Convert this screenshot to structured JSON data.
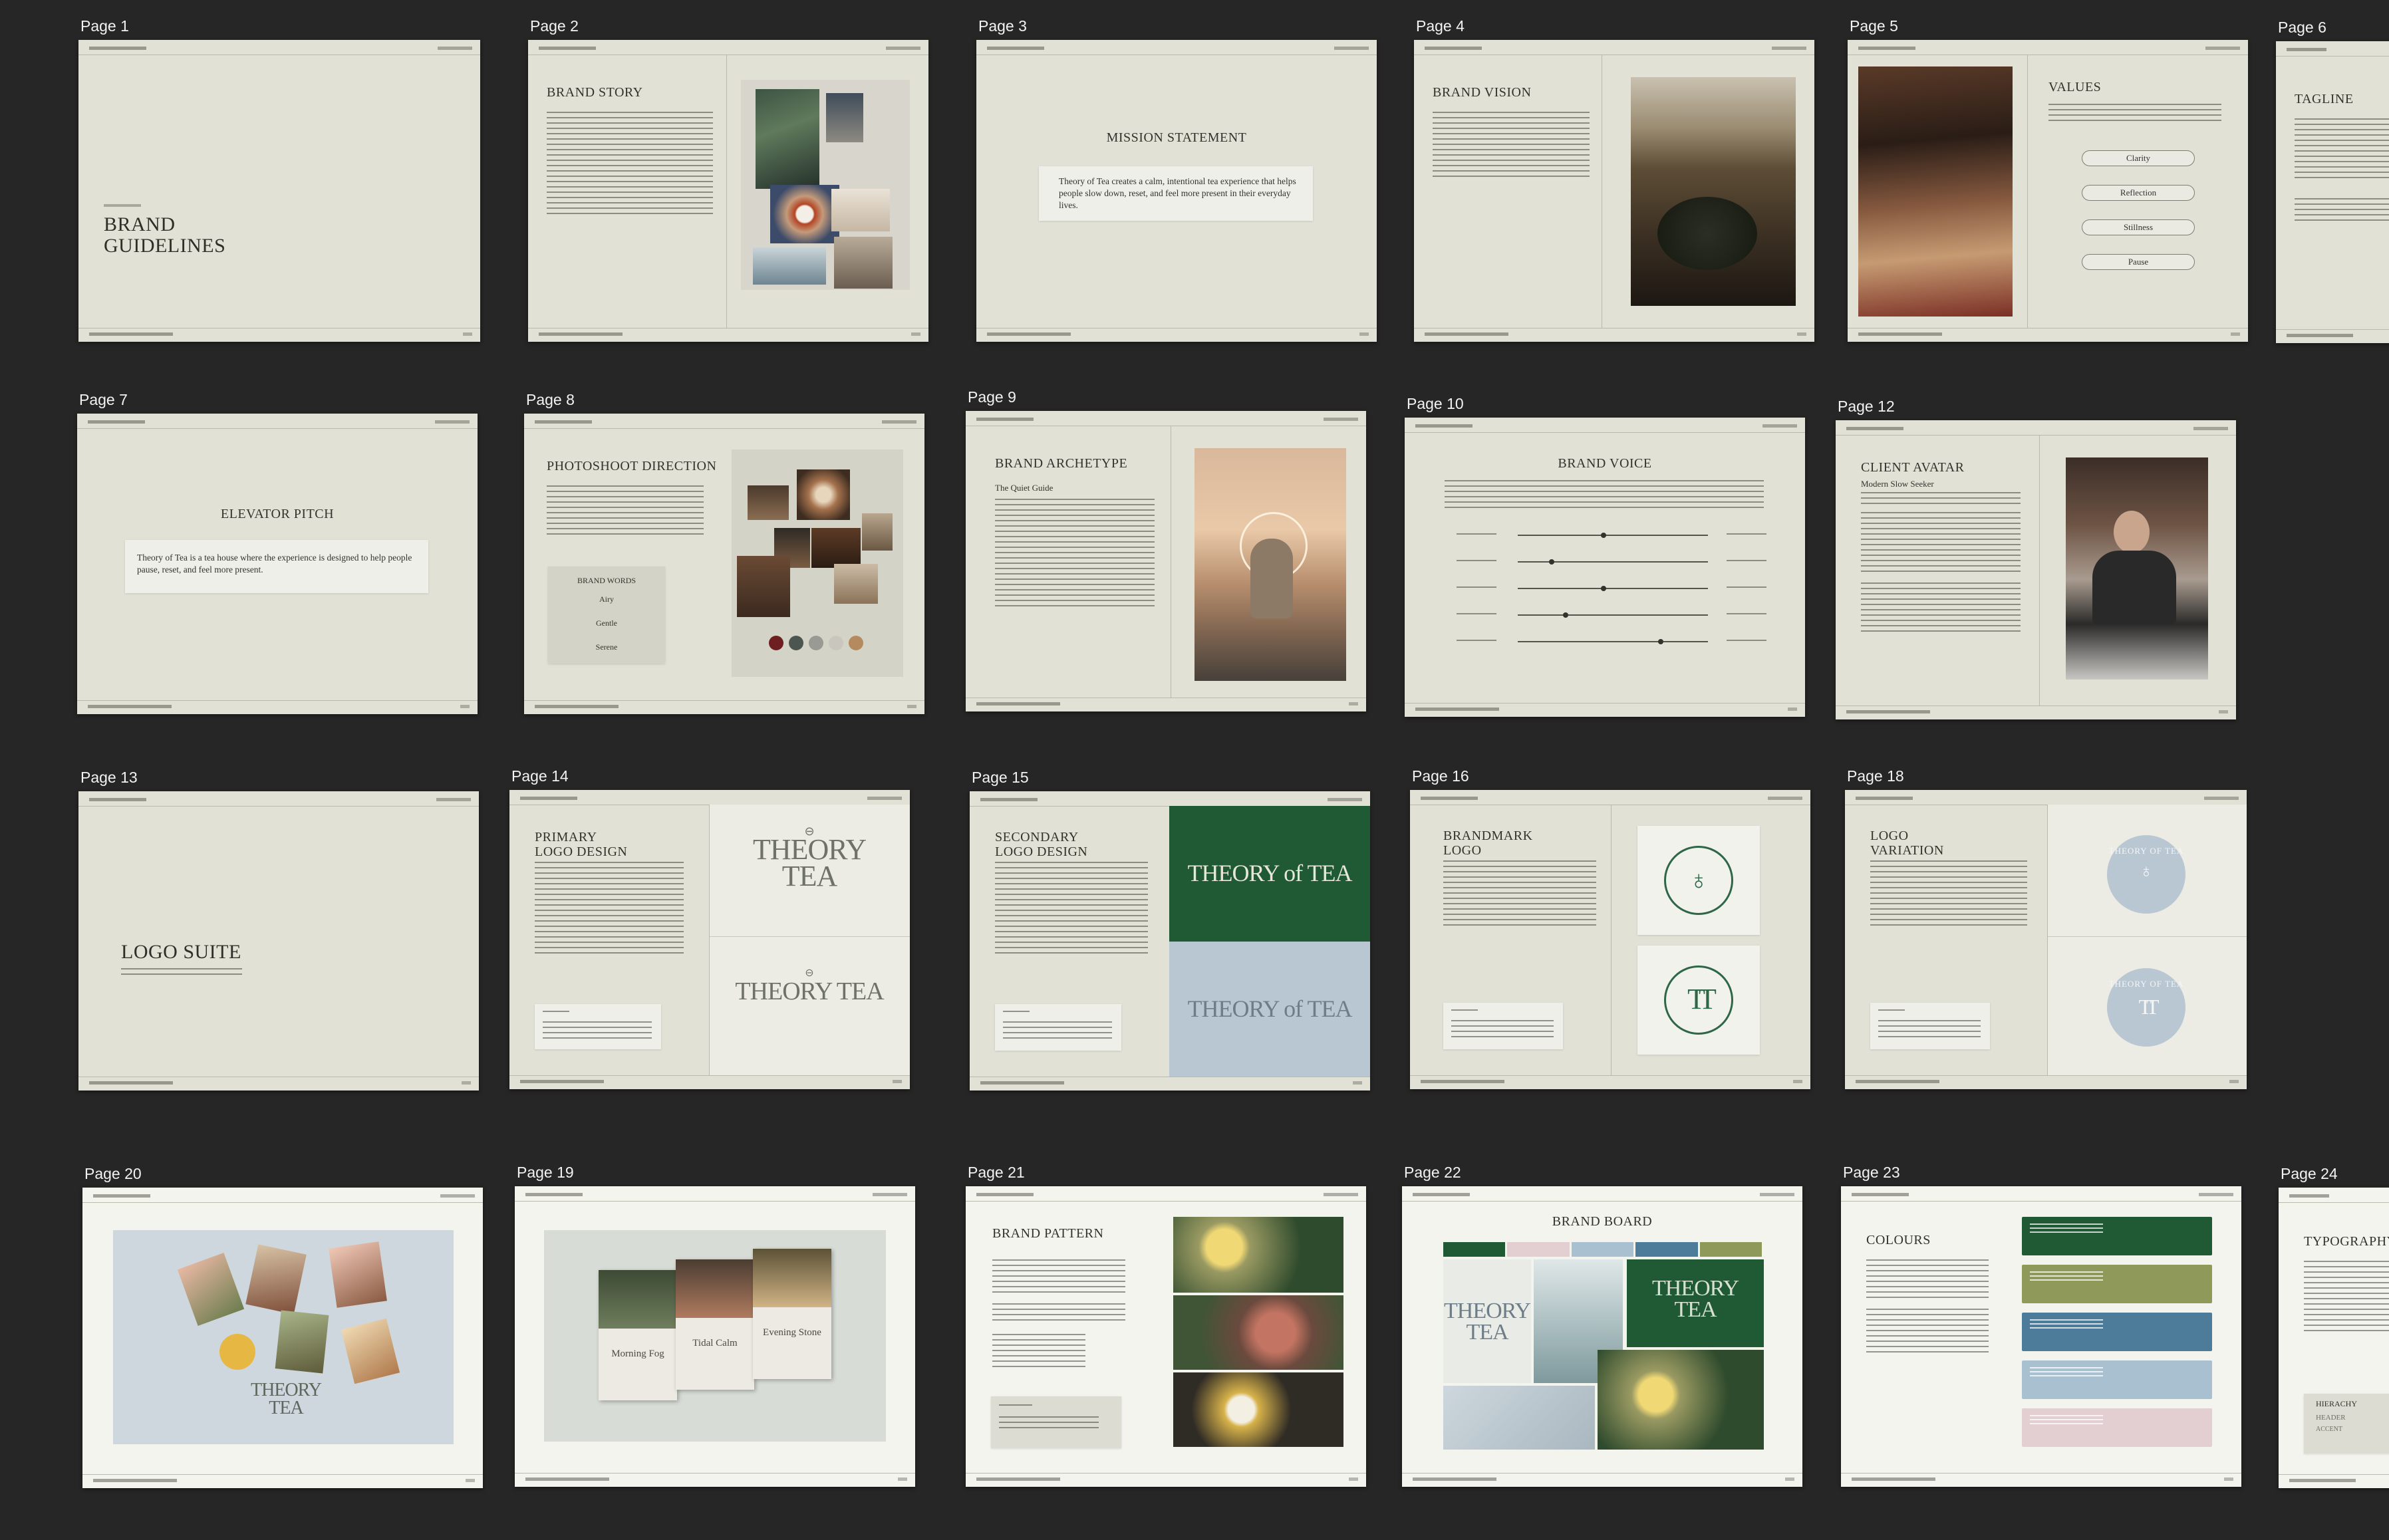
{
  "pages": {
    "p1": {
      "label": "Page 1",
      "title": "BRAND\nGUIDELINES"
    },
    "p2": {
      "label": "Page 2",
      "title": "BRAND STORY"
    },
    "p3": {
      "label": "Page 3",
      "title": "MISSION STATEMENT",
      "body": "Theory of Tea creates a calm, intentional tea experience that helps people slow down, reset, and feel more present in their everyday lives."
    },
    "p4": {
      "label": "Page 4",
      "title": "BRAND VISION"
    },
    "p5": {
      "label": "Page 5",
      "title": "VALUES",
      "values": [
        "Clarity",
        "Reflection",
        "Stillness",
        "Pause"
      ]
    },
    "p6": {
      "label": "Page 6",
      "title": "TAGLINE"
    },
    "p7": {
      "label": "Page 7",
      "title": "ELEVATOR PITCH",
      "body": "Theory of Tea is a tea house where the experience is designed to help people pause, reset, and feel more present."
    },
    "p8": {
      "label": "Page 8",
      "title": "PHOTOSHOOT DIRECTION",
      "words_title": "BRAND WORDS",
      "words": [
        "Airy",
        "Gentle",
        "Serene"
      ],
      "swatches": [
        "#6e1f1f",
        "#4d5550",
        "#9a9a94",
        "#c9c7bd",
        "#b58a5e"
      ]
    },
    "p9": {
      "label": "Page 9",
      "title": "BRAND ARCHETYPE",
      "subtitle": "The Quiet Guide"
    },
    "p10": {
      "label": "Page 10",
      "title": "BRAND VOICE",
      "slider_positions": [
        0.45,
        0.18,
        0.45,
        0.25,
        0.75
      ]
    },
    "p12": {
      "label": "Page 12",
      "title": "CLIENT AVATAR",
      "subtitle": "Modern Slow Seeker"
    },
    "p13": {
      "label": "Page 13",
      "title": "LOGO SUITE"
    },
    "p14": {
      "label": "Page 14",
      "title": "PRIMARY\nLOGO DESIGN",
      "logo_top": "THEORY\nTEA",
      "logo_bottom": "THEORY TEA"
    },
    "p15": {
      "label": "Page 15",
      "title": "SECONDARY\nLOGO DESIGN",
      "logo_a": "THEORY of TEA",
      "logo_b": "THEORY of TEA",
      "colors": {
        "green": "#1f5a34",
        "blue": "#b9c7d2"
      }
    },
    "p16": {
      "label": "Page 16",
      "title": "BRANDMARK\nLOGO",
      "mark_b": "TT"
    },
    "p18": {
      "label": "Page 18",
      "title": "LOGO\nVARIATION",
      "badge_text": "THEORY OF TEA",
      "badge_b": "TT"
    },
    "p20": {
      "label": "Page 20",
      "logo": "THEORY\nTEA"
    },
    "p19": {
      "label": "Page 19",
      "boxes": [
        "Morning Fog",
        "Tidal Calm",
        "Evening Stone"
      ]
    },
    "p21": {
      "label": "Page 21",
      "title": "BRAND PATTERN"
    },
    "p22": {
      "label": "Page 22",
      "title": "BRAND BOARD",
      "logo_a": "THEORY\nTEA",
      "logo_b": "THEORY\nTEA",
      "strip": [
        "#1f5a34",
        "#e3cfd1",
        "#a9c0d1",
        "#4d7c9a",
        "#8f9a5a"
      ]
    },
    "p23": {
      "label": "Page 23",
      "title": "COLOURS",
      "colors": [
        "#1f5a34",
        "#8f9a5a",
        "#4d7c9a",
        "#a9c0d1",
        "#e3cfd1"
      ]
    },
    "p24": {
      "label": "Page 24",
      "title": "TYPOGRAPHY",
      "hier": "HIERACHY",
      "hier2": "HEADER",
      "hier3": "ACCENT"
    }
  }
}
